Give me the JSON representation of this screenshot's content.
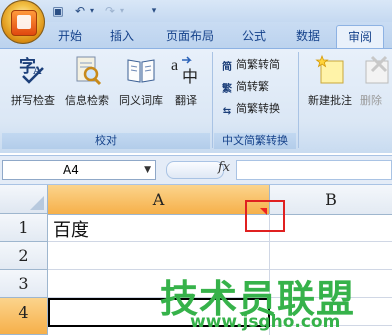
{
  "tabs": [
    "开始",
    "插入",
    "页面布局",
    "公式",
    "数据",
    "审阅"
  ],
  "active_tab": "审阅",
  "ribbon": {
    "proofing": {
      "buttons": [
        "拼写检查",
        "信息检索",
        "同义词库",
        "翻译"
      ],
      "group_label": "校对"
    },
    "chinese_conversion": {
      "buttons": [
        "简繁转简",
        "简转繁",
        "简繁转换"
      ],
      "group_label": "中文简繁转换"
    },
    "comments": {
      "buttons": [
        "新建批注",
        "删除"
      ]
    }
  },
  "formula_bar": {
    "name_box": "A4",
    "fx_label": "fx",
    "formula": ""
  },
  "sheet": {
    "columns": [
      "A",
      "B"
    ],
    "rows": [
      "1",
      "2",
      "3",
      "4"
    ],
    "cells": {
      "A1": "百度"
    }
  },
  "watermark": {
    "title": "技术员联盟",
    "url": "www.jsgho.com"
  },
  "colors": {
    "accent": "#15428b",
    "active_column_header": "#f9b04a",
    "highlight": "#e02020",
    "watermark": "#36b24a"
  }
}
